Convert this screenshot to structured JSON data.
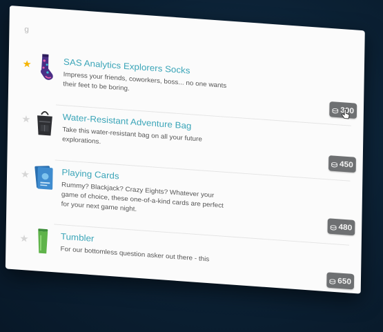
{
  "header": {
    "label": "g"
  },
  "products": [
    {
      "title": "SAS Analytics Explorers Socks",
      "description": "Impress your friends, coworkers, boss... no one wants their feet to be boring.",
      "price": "300",
      "starred": true,
      "image_icon": "socks-icon"
    },
    {
      "title": "Water-Resistant Adventure Bag",
      "description": "Take this water-resistant bag on all your future explorations.",
      "price": "450",
      "starred": false,
      "image_icon": "bag-icon"
    },
    {
      "title": "Playing Cards",
      "description": "Rummy? Blackjack? Crazy Eights? Whatever your game of choice, these one-of-a-kind cards are perfect for your next game night.",
      "price": "480",
      "starred": false,
      "image_icon": "playing-cards-icon"
    },
    {
      "title": "Tumbler",
      "description": "For our bottomless question asker out there - this",
      "price": "650",
      "starred": false,
      "image_icon": "tumbler-icon"
    }
  ],
  "icons": {
    "star": "star-icon",
    "coin": "coin-stack-icon",
    "cursor": "hand-pointer-icon"
  },
  "colors": {
    "title": "#3ba5b8",
    "star_active": "#f5b400",
    "star_inactive": "#d6d6d6",
    "price_button": "#6e7072",
    "background": "#0b2033"
  }
}
